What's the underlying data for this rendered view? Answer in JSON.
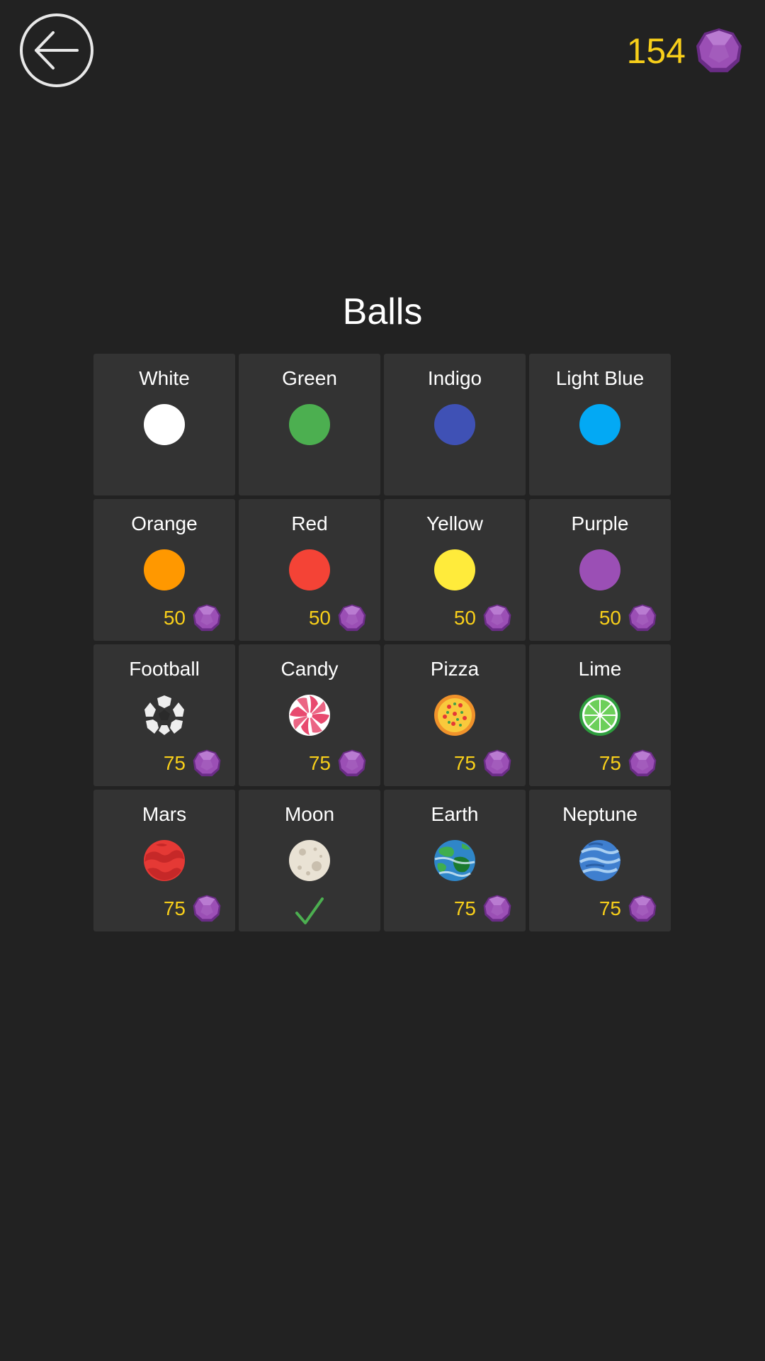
{
  "header": {
    "gem_count": "154"
  },
  "title": "Balls",
  "balls": [
    {
      "name": "White",
      "ball": "white-ball-icon",
      "price": null,
      "owned": false
    },
    {
      "name": "Green",
      "ball": "green-ball-icon",
      "price": null,
      "owned": false
    },
    {
      "name": "Indigo",
      "ball": "indigo-ball-icon",
      "price": null,
      "owned": false
    },
    {
      "name": "Light Blue",
      "ball": "light-blue-ball-icon",
      "price": null,
      "owned": false
    },
    {
      "name": "Orange",
      "ball": "orange-ball-icon",
      "price": "50",
      "owned": false
    },
    {
      "name": "Red",
      "ball": "red-ball-icon",
      "price": "50",
      "owned": false
    },
    {
      "name": "Yellow",
      "ball": "yellow-ball-icon",
      "price": "50",
      "owned": false
    },
    {
      "name": "Purple",
      "ball": "purple-ball-icon",
      "price": "50",
      "owned": false
    },
    {
      "name": "Football",
      "ball": "football-icon",
      "price": "75",
      "owned": false
    },
    {
      "name": "Candy",
      "ball": "candy-icon",
      "price": "75",
      "owned": false
    },
    {
      "name": "Pizza",
      "ball": "pizza-icon",
      "price": "75",
      "owned": false
    },
    {
      "name": "Lime",
      "ball": "lime-icon",
      "price": "75",
      "owned": false
    },
    {
      "name": "Mars",
      "ball": "mars-icon",
      "price": "75",
      "owned": false
    },
    {
      "name": "Moon",
      "ball": "moon-icon",
      "price": null,
      "owned": true
    },
    {
      "name": "Earth",
      "ball": "earth-icon",
      "price": "75",
      "owned": false
    },
    {
      "name": "Neptune",
      "ball": "neptune-icon",
      "price": "75",
      "owned": false
    }
  ],
  "colors": {
    "background": "#222222",
    "tile": "#333333",
    "price_text": "#f8cf1a",
    "gem": "#9b4fb5",
    "check": "#4caf50",
    "white": "#ffffff",
    "green": "#4caf50",
    "indigo": "#3f51b5",
    "light_blue": "#03a9f4",
    "orange": "#ff9800",
    "red": "#f44336",
    "yellow": "#ffeb3b",
    "purple": "#9b4fb5"
  }
}
